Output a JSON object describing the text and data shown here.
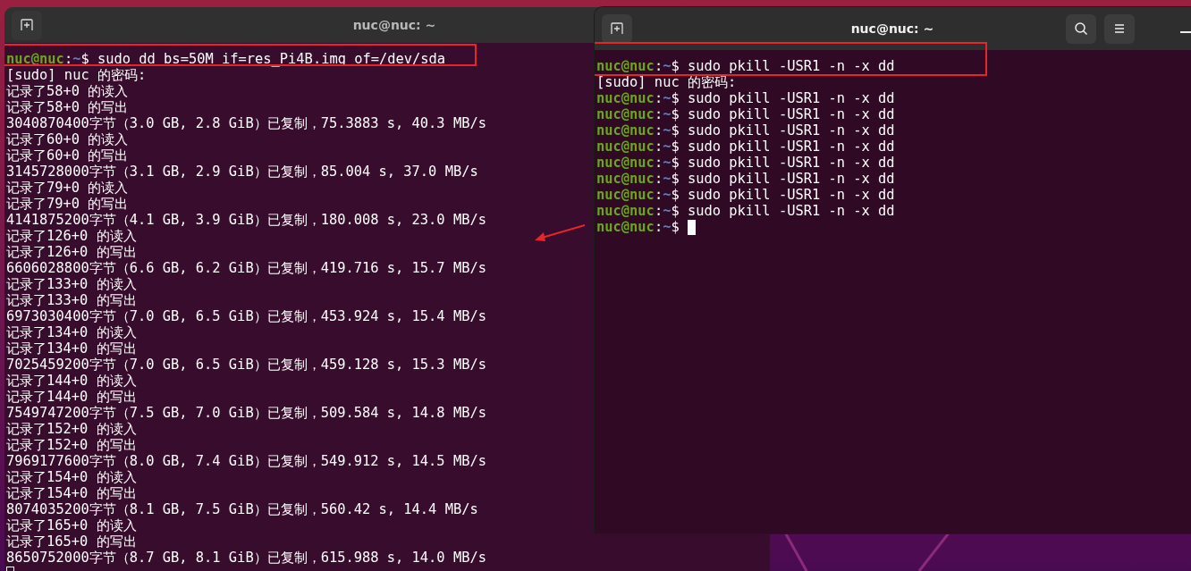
{
  "windows": [
    {
      "title": "nuc@nuc: ~",
      "focused": false,
      "highlight_box": true,
      "lines": [
        {
          "kind": "prompt",
          "user": "nuc@nuc",
          "sep": ":",
          "path": "~",
          "symbol": "$",
          "command": "sudo dd bs=50M if=res_Pi4B.img of=/dev/sda"
        },
        {
          "kind": "output",
          "text": "[sudo] nuc 的密码:"
        },
        {
          "kind": "output",
          "text": "记录了58+0 的读入"
        },
        {
          "kind": "output",
          "text": "记录了58+0 的写出"
        },
        {
          "kind": "output",
          "text": "3040870400字节（3.0 GB, 2.8 GiB）已复制，75.3883 s, 40.3 MB/s"
        },
        {
          "kind": "output",
          "text": "记录了60+0 的读入"
        },
        {
          "kind": "output",
          "text": "记录了60+0 的写出"
        },
        {
          "kind": "output",
          "text": "3145728000字节（3.1 GB, 2.9 GiB）已复制，85.004 s, 37.0 MB/s"
        },
        {
          "kind": "output",
          "text": "记录了79+0 的读入"
        },
        {
          "kind": "output",
          "text": "记录了79+0 的写出"
        },
        {
          "kind": "output",
          "text": "4141875200字节（4.1 GB, 3.9 GiB）已复制，180.008 s, 23.0 MB/s"
        },
        {
          "kind": "output",
          "text": "记录了126+0 的读入"
        },
        {
          "kind": "output",
          "text": "记录了126+0 的写出"
        },
        {
          "kind": "output",
          "text": "6606028800字节（6.6 GB, 6.2 GiB）已复制，419.716 s, 15.7 MB/s"
        },
        {
          "kind": "output",
          "text": "记录了133+0 的读入"
        },
        {
          "kind": "output",
          "text": "记录了133+0 的写出"
        },
        {
          "kind": "output",
          "text": "6973030400字节（7.0 GB, 6.5 GiB）已复制，453.924 s, 15.4 MB/s"
        },
        {
          "kind": "output",
          "text": "记录了134+0 的读入"
        },
        {
          "kind": "output",
          "text": "记录了134+0 的写出"
        },
        {
          "kind": "output",
          "text": "7025459200字节（7.0 GB, 6.5 GiB）已复制，459.128 s, 15.3 MB/s"
        },
        {
          "kind": "output",
          "text": "记录了144+0 的读入"
        },
        {
          "kind": "output",
          "text": "记录了144+0 的写出"
        },
        {
          "kind": "output",
          "text": "7549747200字节（7.5 GB, 7.0 GiB）已复制，509.584 s, 14.8 MB/s"
        },
        {
          "kind": "output",
          "text": "记录了152+0 的读入"
        },
        {
          "kind": "output",
          "text": "记录了152+0 的写出"
        },
        {
          "kind": "output",
          "text": "7969177600字节（8.0 GB, 7.4 GiB）已复制，549.912 s, 14.5 MB/s"
        },
        {
          "kind": "output",
          "text": "记录了154+0 的读入"
        },
        {
          "kind": "output",
          "text": "记录了154+0 的写出"
        },
        {
          "kind": "output",
          "text": "8074035200字节（8.1 GB, 7.5 GiB）已复制，560.42 s, 14.4 MB/s"
        },
        {
          "kind": "output",
          "text": "记录了165+0 的读入"
        },
        {
          "kind": "output",
          "text": "记录了165+0 的写出"
        },
        {
          "kind": "output",
          "text": "8650752000字节（8.7 GB, 8.1 GiB）已复制，615.988 s, 14.0 MB/s"
        },
        {
          "kind": "empty"
        }
      ]
    },
    {
      "title": "nuc@nuc: ~",
      "focused": true,
      "highlight_box": true,
      "lines": [
        {
          "kind": "prompt",
          "user": "nuc@nuc",
          "sep": ":",
          "path": "~",
          "symbol": "$",
          "command": "sudo pkill -USR1 -n -x dd"
        },
        {
          "kind": "output",
          "text": "[sudo] nuc 的密码:"
        },
        {
          "kind": "prompt",
          "user": "nuc@nuc",
          "sep": ":",
          "path": "~",
          "symbol": "$",
          "command": "sudo pkill -USR1 -n -x dd"
        },
        {
          "kind": "prompt",
          "user": "nuc@nuc",
          "sep": ":",
          "path": "~",
          "symbol": "$",
          "command": "sudo pkill -USR1 -n -x dd"
        },
        {
          "kind": "prompt",
          "user": "nuc@nuc",
          "sep": ":",
          "path": "~",
          "symbol": "$",
          "command": "sudo pkill -USR1 -n -x dd"
        },
        {
          "kind": "prompt",
          "user": "nuc@nuc",
          "sep": ":",
          "path": "~",
          "symbol": "$",
          "command": "sudo pkill -USR1 -n -x dd"
        },
        {
          "kind": "prompt",
          "user": "nuc@nuc",
          "sep": ":",
          "path": "~",
          "symbol": "$",
          "command": "sudo pkill -USR1 -n -x dd"
        },
        {
          "kind": "prompt",
          "user": "nuc@nuc",
          "sep": ":",
          "path": "~",
          "symbol": "$",
          "command": "sudo pkill -USR1 -n -x dd"
        },
        {
          "kind": "prompt",
          "user": "nuc@nuc",
          "sep": ":",
          "path": "~",
          "symbol": "$",
          "command": "sudo pkill -USR1 -n -x dd"
        },
        {
          "kind": "prompt",
          "user": "nuc@nuc",
          "sep": ":",
          "path": "~",
          "symbol": "$",
          "command": "sudo pkill -USR1 -n -x dd"
        },
        {
          "kind": "prompt",
          "user": "nuc@nuc",
          "sep": ":",
          "path": "~",
          "symbol": "$"
        }
      ]
    }
  ],
  "annotation_arrow": true
}
